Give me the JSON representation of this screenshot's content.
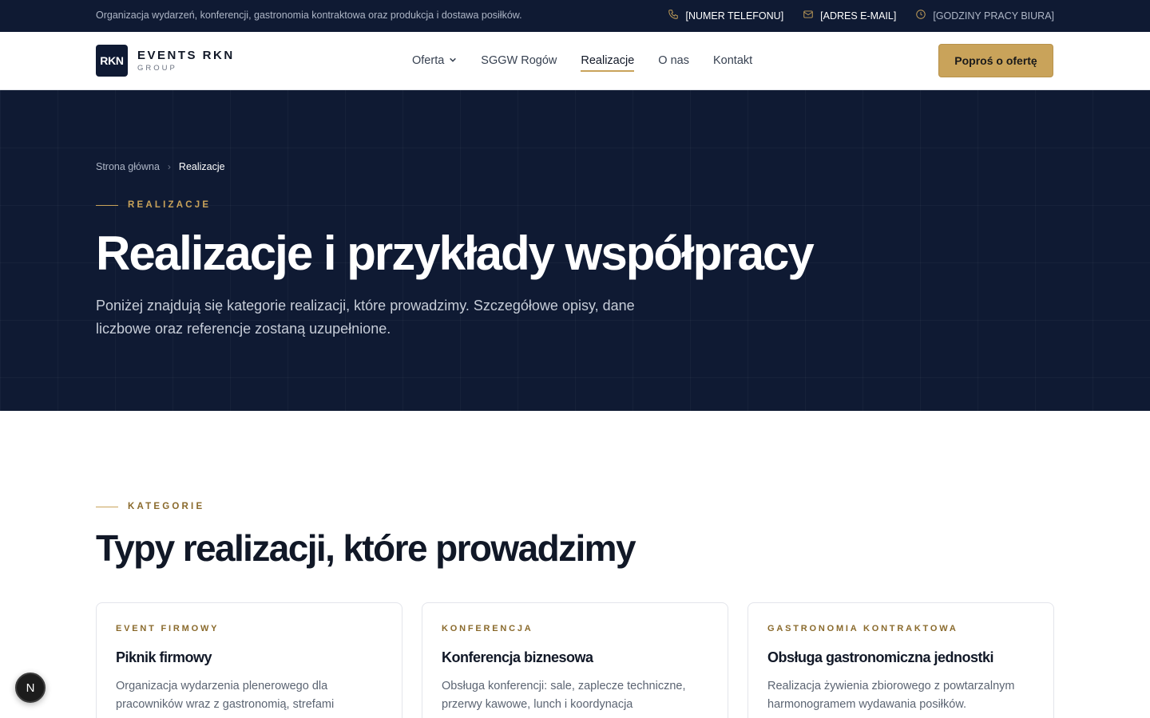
{
  "topbar": {
    "tagline": "Organizacja wydarzeń, konferencji, gastronomia kontraktowa oraz produkcja i dostawa posiłków.",
    "phone": "[NUMER TELEFONU]",
    "email": "[ADRES E-MAIL]",
    "hours": "[GODZINY PRACY BIURA]",
    "icons": [
      "phone-icon",
      "mail-icon",
      "clock-icon"
    ]
  },
  "logo": {
    "mark": "RKN",
    "name": "EVENTS RKN",
    "sub": "GROUP"
  },
  "nav": {
    "items": [
      {
        "label": "Oferta",
        "has_dropdown": true
      },
      {
        "label": "SGGW Rogów"
      },
      {
        "label": "Realizacje",
        "active": true
      },
      {
        "label": "O nas"
      },
      {
        "label": "Kontakt"
      }
    ],
    "cta": "Poproś o ofertę"
  },
  "hero": {
    "breadcrumb": {
      "home": "Strona główna",
      "current": "Realizacje"
    },
    "eyebrow": "REALIZACJE",
    "title": "Realizacje i przykłady współpracy",
    "lead": "Poniżej znajdują się kategorie realizacji, które prowadzimy. Szczegółowe opisy, dane liczbowe oraz referencje zostaną uzupełnione."
  },
  "categories": {
    "eyebrow": "KATEGORIE",
    "title": "Typy realizacji, które prowadzimy",
    "cards": [
      {
        "category": "EVENT FIRMOWY",
        "title": "Piknik firmowy",
        "description": "Organizacja wydarzenia plenerowego dla pracowników wraz z gastronomią, strefami"
      },
      {
        "category": "KONFERENCJA",
        "title": "Konferencja biznesowa",
        "description": "Obsługa konferencji: sale, zaplecze techniczne, przerwy kawowe, lunch i koordynacja"
      },
      {
        "category": "GASTRONOMIA KONTRAKTOWA",
        "title": "Obsługa gastronomiczna jednostki",
        "description": "Realizacja żywienia zbiorowego z powtarzalnym harmonogramem wydawania posiłków."
      }
    ]
  },
  "fab": {
    "label": "N"
  },
  "colors": {
    "navy": "#0f1a33",
    "gold": "#c9a35a"
  }
}
